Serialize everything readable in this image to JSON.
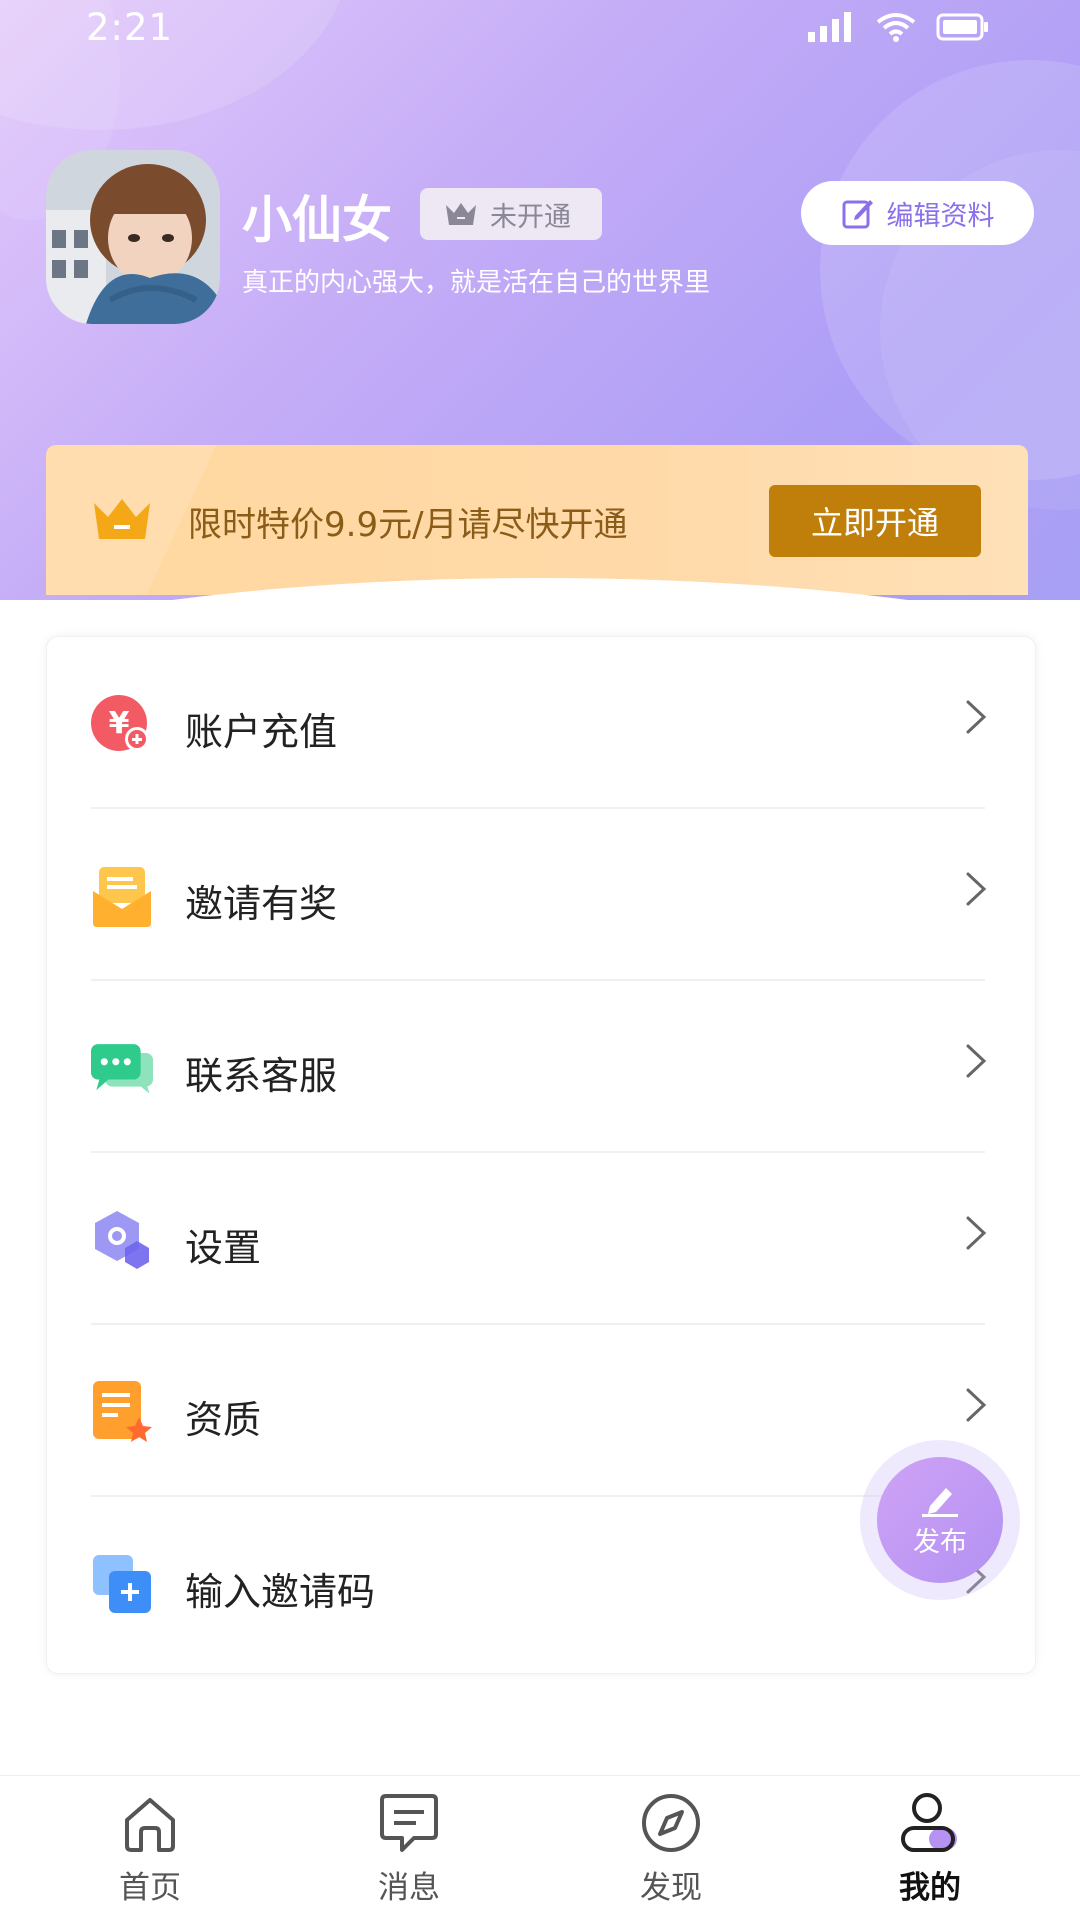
{
  "status_bar": {
    "time": "2:21"
  },
  "profile": {
    "name": "小仙女",
    "vip_status": "未开通",
    "bio": "真正的内心强大，就是活在自己的世界里",
    "edit_label": "编辑资料"
  },
  "vip_banner": {
    "text": "限时特价9.9元/月请尽快开通",
    "button": "立即开通"
  },
  "menu": [
    {
      "label": "账户充值",
      "icon": "recharge-icon"
    },
    {
      "label": "邀请有奖",
      "icon": "invite-reward-icon"
    },
    {
      "label": "联系客服",
      "icon": "customer-service-icon"
    },
    {
      "label": "设置",
      "icon": "settings-icon"
    },
    {
      "label": "资质",
      "icon": "qualification-icon"
    },
    {
      "label": "输入邀请码",
      "icon": "invite-code-icon"
    }
  ],
  "fab": {
    "label": "发布"
  },
  "tabs": [
    {
      "label": "首页",
      "icon": "home-icon",
      "active": false
    },
    {
      "label": "消息",
      "icon": "message-icon",
      "active": false
    },
    {
      "label": "发现",
      "icon": "discover-icon",
      "active": false
    },
    {
      "label": "我的",
      "icon": "profile-icon",
      "active": true
    }
  ],
  "colors": {
    "header_gradient_start": "#e3c9fb",
    "header_gradient_end": "#a8a0f5",
    "vip_button": "#c07e0a",
    "vip_text": "#8a5c18",
    "accent": "#8b70ec"
  }
}
